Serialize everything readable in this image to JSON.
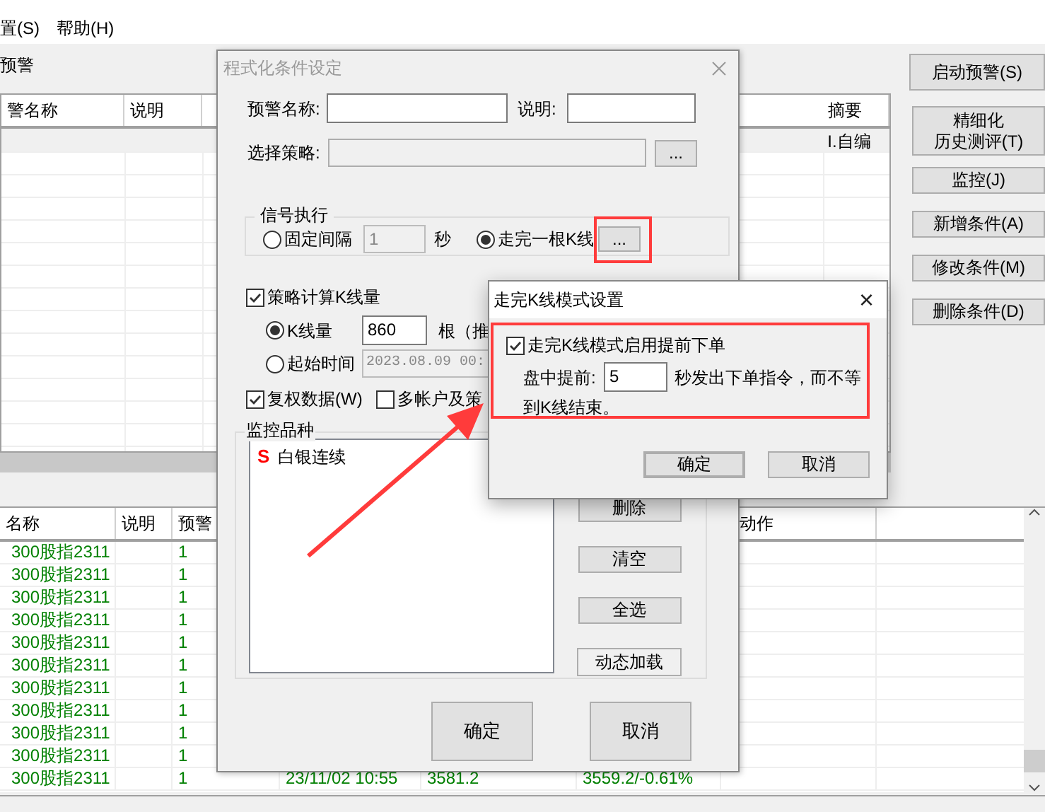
{
  "menu": [
    {
      "label": "置(S)"
    },
    {
      "label": "帮助(H)"
    }
  ],
  "panel_title": "预警",
  "upper_table": {
    "columns": [
      "警名称",
      "说明",
      "摘要"
    ],
    "rows": [
      {
        "summary": "I.自编",
        "selected": true
      }
    ]
  },
  "lower_table": {
    "columns": [
      "名称",
      "说明",
      "预警",
      "动作"
    ],
    "rows": [
      {
        "name": "300股指2311",
        "count": "1"
      },
      {
        "name": "300股指2311",
        "count": "1"
      },
      {
        "name": "300股指2311",
        "count": "1"
      },
      {
        "name": "300股指2311",
        "count": "1"
      },
      {
        "name": "300股指2311",
        "count": "1"
      },
      {
        "name": "300股指2311",
        "count": "1"
      },
      {
        "name": "300股指2311",
        "count": "1"
      },
      {
        "name": "300股指2311",
        "count": "1"
      },
      {
        "name": "300股指2311",
        "count": "1"
      },
      {
        "name": "300股指2311",
        "count": "1"
      },
      {
        "name": "300股指2311",
        "count": "1",
        "time": "23/11/02 10:55",
        "price": "3581.2",
        "quote": "3559.2/-0.61%"
      }
    ]
  },
  "side_buttons": [
    {
      "lines": [
        "启动预警(S)"
      ]
    },
    {
      "lines": [
        "精细化",
        "历史测评(T)"
      ]
    },
    {
      "lines": [
        "监控(J)"
      ]
    },
    {
      "lines": [
        "新增条件(A)"
      ]
    },
    {
      "lines": [
        "修改条件(M)"
      ]
    },
    {
      "lines": [
        "删除条件(D)"
      ]
    }
  ],
  "dialog": {
    "title": "程式化条件设定",
    "name_label": "预警名称:",
    "note_label": "说明:",
    "strategy_label": "选择策略:",
    "browse": "...",
    "signal": {
      "title": "信号执行",
      "options": [
        {
          "label": "固定间隔",
          "selected": false
        },
        {
          "label": "走完一根K线",
          "selected": true
        }
      ],
      "interval": "1",
      "unit": "秒",
      "settings": "..."
    },
    "bars": {
      "label": "策略计算K线量",
      "checked": true,
      "options": [
        {
          "label": "K线量",
          "selected": true,
          "value": "860",
          "suffix": "根（推"
        },
        {
          "label": "起始时间",
          "selected": false,
          "value": "2023.08.09 00:"
        }
      ]
    },
    "adjusted": {
      "label": "复权数据(W)",
      "checked": true
    },
    "multi": {
      "label": "多帐户及策",
      "checked": false
    },
    "watch": {
      "title": "监控品种",
      "items": [
        {
          "badge": "S",
          "name": "白银连续"
        }
      ],
      "buttons": [
        "删除",
        "清空",
        "全选",
        "动态加载"
      ]
    },
    "ok": "确定",
    "cancel": "取消"
  },
  "popup": {
    "title": "走完K线模式设置",
    "close": "×",
    "enable": {
      "label": "走完K线模式启用提前下单",
      "checked": true
    },
    "ahead_label": "盘中提前:",
    "ahead": "5",
    "text1": "秒发出下单指令，而不等",
    "text2": "到K线结束。",
    "ok": "确定",
    "cancel": "取消"
  }
}
